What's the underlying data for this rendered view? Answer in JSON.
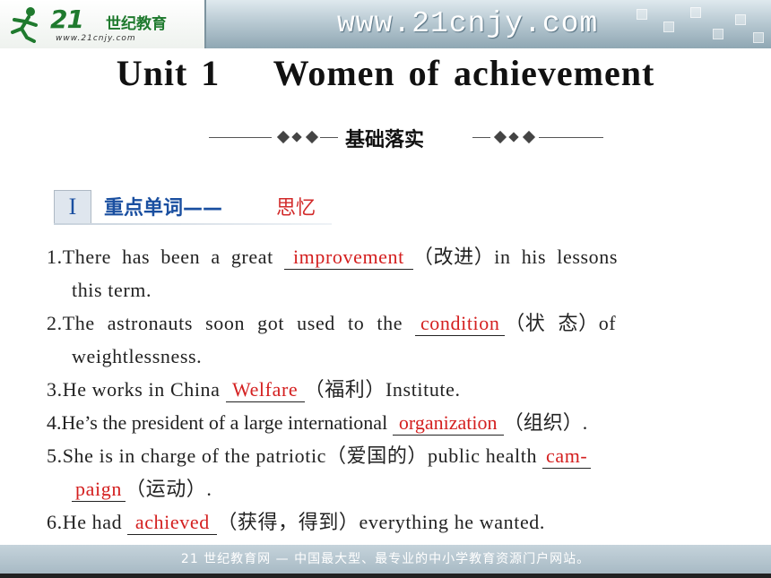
{
  "header": {
    "logo_number": "21",
    "logo_chinese": "世纪教育",
    "logo_url": "www.21cnjy.com",
    "site_url": "www.21cnjy.com"
  },
  "title": "Unit 1    Women of achievement",
  "section_label": "基础落实",
  "vocab": {
    "roman": "I",
    "title": "重点单词——",
    "subtitle": "思忆"
  },
  "items": [
    {
      "num": "1.",
      "before": "There has been a great ",
      "answer": "improvement",
      "after": "（改进）in his lessons",
      "cont": "this term."
    },
    {
      "num": "2.",
      "before": "The astronauts soon got used to the ",
      "answer": "condition",
      "after": "（状 态）of",
      "cont": "weightlessness."
    },
    {
      "num": "3.",
      "before": "He works in China ",
      "answer": "Welfare",
      "after": "（福利）Institute."
    },
    {
      "num": "4.",
      "before": "He’s the president of a large international ",
      "answer": "organization",
      "after": "（组织）."
    },
    {
      "num": "5.",
      "before": "She is in charge of the patriotic（爱国的）public health ",
      "answer": "cam-",
      "cont_answer": "paign",
      "cont_after": "（运动）."
    },
    {
      "num": "6.",
      "before": "He had ",
      "answer": "achieved",
      "after": "（获得，得到）everything he wanted."
    }
  ],
  "footer": "21 世纪教育网 — 中国最大型、最专业的中小学教育资源门户网站。",
  "colors": {
    "answer": "#d42020",
    "heading_blue": "#1a4fa0",
    "subtitle_red": "#d22a2a"
  }
}
